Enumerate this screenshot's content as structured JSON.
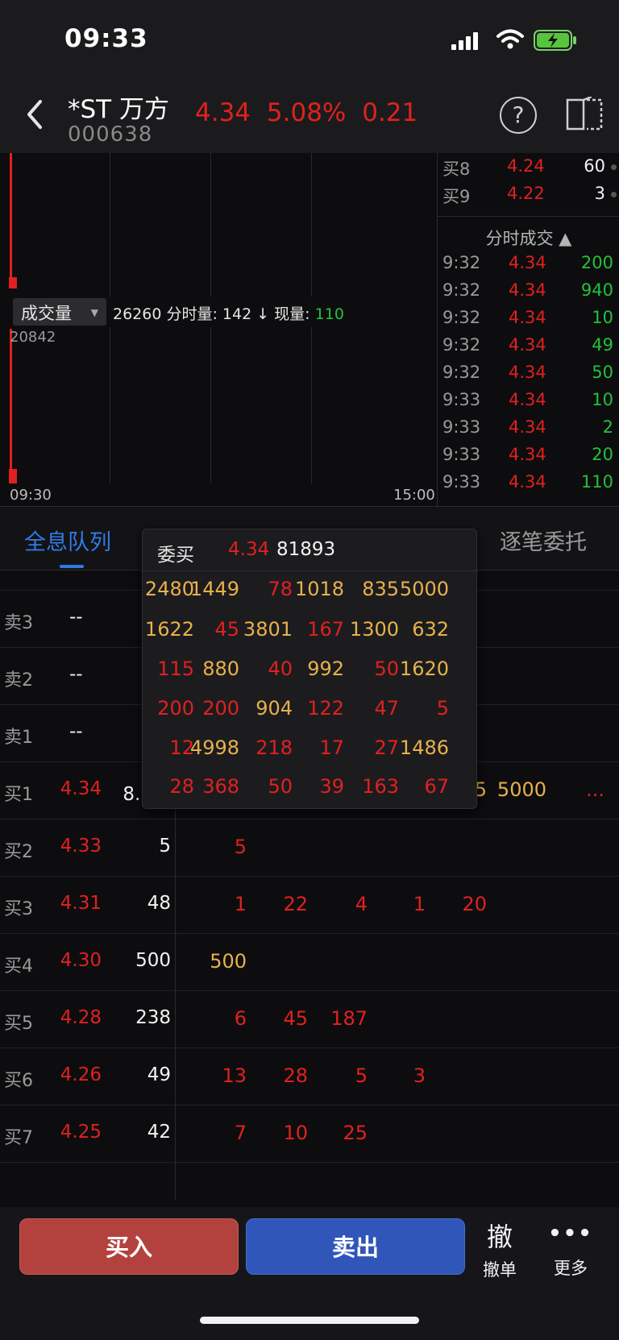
{
  "status_bar": {
    "time": "09:33"
  },
  "header": {
    "name": "*ST 万方",
    "code": "000638",
    "price": "4.34",
    "change_pct": "5.08%",
    "change": "0.21",
    "help_glyph": "?"
  },
  "chart": {
    "volume_selector": "成交量",
    "volume_info_prefix": "26260 分时量: 142 ↓ 现量: ",
    "volume_info_current": "110",
    "volume_max": "20842",
    "time_start": "09:30",
    "time_end": "15:00"
  },
  "right_panel": {
    "bids": [
      {
        "label": "买8",
        "price": "4.24",
        "volume": "60"
      },
      {
        "label": "买9",
        "price": "4.22",
        "volume": "3"
      }
    ],
    "ticks_header": "分时成交 ▲",
    "ticks": [
      {
        "time": "9:32",
        "price": "4.34",
        "volume": "200"
      },
      {
        "time": "9:32",
        "price": "4.34",
        "volume": "940"
      },
      {
        "time": "9:32",
        "price": "4.34",
        "volume": "10"
      },
      {
        "time": "9:32",
        "price": "4.34",
        "volume": "49"
      },
      {
        "time": "9:32",
        "price": "4.34",
        "volume": "50"
      },
      {
        "time": "9:33",
        "price": "4.34",
        "volume": "10"
      },
      {
        "time": "9:33",
        "price": "4.34",
        "volume": "2"
      },
      {
        "time": "9:33",
        "price": "4.34",
        "volume": "20"
      },
      {
        "time": "9:33",
        "price": "4.34",
        "volume": "110"
      }
    ]
  },
  "tabs": {
    "active": "全息队列",
    "right": "逐笔委托"
  },
  "book": {
    "asks": [
      {
        "label": "卖3",
        "price": "--"
      },
      {
        "label": "卖2",
        "price": "--"
      },
      {
        "label": "卖1",
        "price": "--"
      }
    ],
    "bids": [
      {
        "label": "买1",
        "price": "4.34",
        "volume": "8.2万",
        "queue": [
          "2480",
          "1449",
          "78",
          "1018",
          "835",
          "5000"
        ],
        "more": "..."
      },
      {
        "label": "买2",
        "price": "4.33",
        "volume": "5",
        "queue": [
          "5"
        ]
      },
      {
        "label": "买3",
        "price": "4.31",
        "volume": "48",
        "queue": [
          "1",
          "22",
          "4",
          "1",
          "20"
        ]
      },
      {
        "label": "买4",
        "price": "4.30",
        "volume": "500",
        "queue": [
          "500"
        ]
      },
      {
        "label": "买5",
        "price": "4.28",
        "volume": "238",
        "queue": [
          "6",
          "45",
          "187"
        ]
      },
      {
        "label": "买6",
        "price": "4.26",
        "volume": "49",
        "queue": [
          "13",
          "28",
          "5",
          "3"
        ]
      },
      {
        "label": "买7",
        "price": "4.25",
        "volume": "42",
        "queue": [
          "7",
          "10",
          "25"
        ]
      }
    ]
  },
  "popup": {
    "title": "委买",
    "price": "4.34",
    "total": "81893",
    "rows": [
      [
        "2480",
        "1449",
        "78",
        "1018",
        "835",
        "5000"
      ],
      [
        "1622",
        "45",
        "3801",
        "167",
        "1300",
        "632"
      ],
      [
        "115",
        "880",
        "40",
        "992",
        "50",
        "1620"
      ],
      [
        "200",
        "200",
        "904",
        "122",
        "47",
        "5"
      ],
      [
        "12",
        "4998",
        "218",
        "17",
        "27",
        "1486"
      ],
      [
        "28",
        "368",
        "50",
        "39",
        "163",
        "67"
      ]
    ]
  },
  "bottom": {
    "buy": "买入",
    "sell": "卖出",
    "cancel_glyph": "撤",
    "cancel": "撤单",
    "more_glyph": "•••",
    "more": "更多"
  },
  "colors": {
    "up": "#e0211f",
    "down": "#24c13a",
    "large_order": "#e8b14a",
    "accent": "#2f7be5",
    "buy_button": "#b3423e",
    "sell_button": "#2f56b8"
  }
}
